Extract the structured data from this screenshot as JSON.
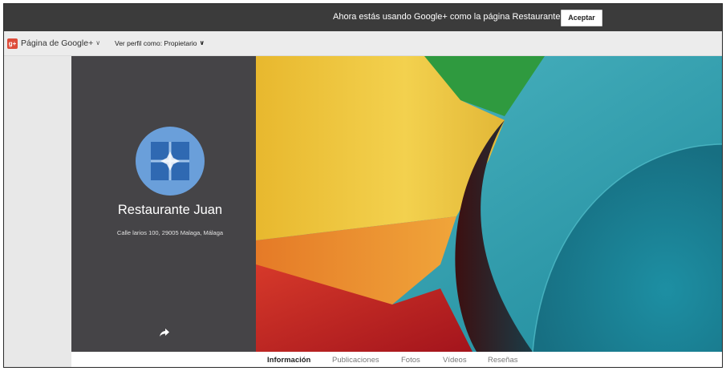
{
  "notice": {
    "message": "Ahora estás usando Google+ como la página Restaurante Juan.",
    "accept_label": "Aceptar"
  },
  "toolbar": {
    "gplus_glyph": "g+",
    "page_switcher_label": "Página de Google+",
    "view_as_label": "Ver perfil como: Propietario"
  },
  "profile": {
    "name": "Restaurante Juan",
    "address": "Calle larios 100, 29005 Malaga, Málaga",
    "avatar_icon": "restaurant-logo-icon",
    "share_icon": "share-arrow-icon"
  },
  "tabs": [
    {
      "label": "Información",
      "active": true
    },
    {
      "label": "Publicaciones",
      "active": false
    },
    {
      "label": "Fotos",
      "active": false
    },
    {
      "label": "Vídeos",
      "active": false
    },
    {
      "label": "Reseñas",
      "active": false
    }
  ],
  "colors": {
    "notice_bar": "#3b3b3b",
    "profile_panel": "#454447",
    "avatar_circle": "#6a9fda",
    "avatar_square": "#2f69b2",
    "gplus_red": "#dd4b39"
  }
}
